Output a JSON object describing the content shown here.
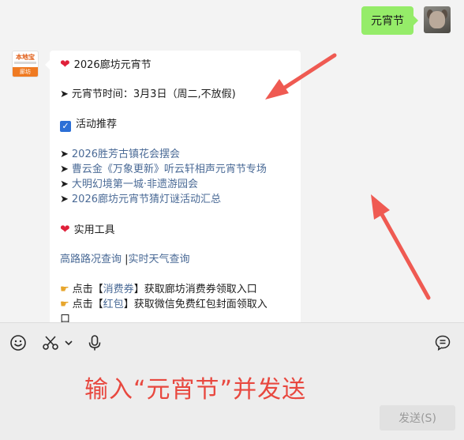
{
  "user_message": {
    "text": "元宵节"
  },
  "bot_message": {
    "title": "2026廊坊元宵节",
    "festival_time": "元宵节时间：3月3日（周二,不放假)",
    "recommend_title": "活动推荐",
    "recommend_links": [
      "2026胜芳古镇花会摆会",
      "曹云金《万象更新》听云轩相声元宵节专场",
      "大明幻境第一城·非遗游园会",
      "2026廊坊元宵节猜灯谜活动汇总"
    ],
    "tools_title": "实用工具",
    "tool_link_1": "高路路况查询",
    "tool_separator": "|",
    "tool_link_2": "实时天气查询",
    "coupon_prefix": "点击【",
    "coupon_link": "消费券",
    "coupon_suffix": "】获取廊坊消费券领取入口",
    "redpack_prefix": "点击【",
    "redpack_link": "红包",
    "redpack_suffix": "】获取微信免费红包封面领取入",
    "redpack_wrap": "口"
  },
  "bot_avatar": {
    "logo_top": "本地宝",
    "logo_bottom": "廊坊"
  },
  "instruction": "输入“元宵节”并发送",
  "send_button": "发送(S)",
  "icons": [
    "emoji-icon",
    "scissors-icon",
    "chevron-down-icon",
    "microphone-icon",
    "chat-history-icon"
  ],
  "colors": {
    "user_bubble": "#95ec69",
    "link": "#4a6a96",
    "instruction": "#e8483f",
    "heart": "#e0203a"
  }
}
